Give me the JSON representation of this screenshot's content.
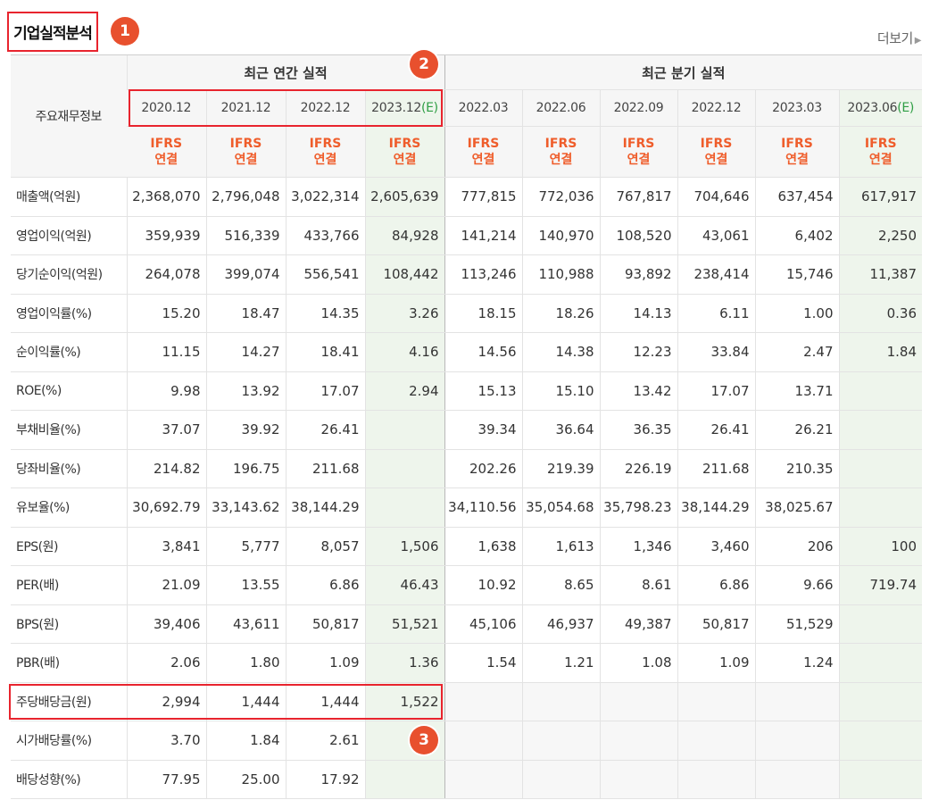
{
  "section": {
    "title": "기업실적분석",
    "more_label": "더보기"
  },
  "badges": [
    "1",
    "2",
    "3"
  ],
  "header": {
    "row_header": "주요재무정보",
    "annual_group": "최근 연간 실적",
    "quarter_group": "최근 분기 실적",
    "annual_periods": [
      {
        "label": "2020.12",
        "est": ""
      },
      {
        "label": "2021.12",
        "est": ""
      },
      {
        "label": "2022.12",
        "est": ""
      },
      {
        "label": "2023.12",
        "est": "(E)"
      }
    ],
    "quarter_periods": [
      {
        "label": "2022.03",
        "est": ""
      },
      {
        "label": "2022.06",
        "est": ""
      },
      {
        "label": "2022.09",
        "est": ""
      },
      {
        "label": "2022.12",
        "est": ""
      },
      {
        "label": "2023.03",
        "est": ""
      },
      {
        "label": "2023.06",
        "est": "(E)"
      }
    ],
    "ifrs_top": "IFRS",
    "ifrs_bottom": "연결"
  },
  "rows": [
    {
      "label": "매출액(억원)",
      "values": [
        "2,368,070",
        "2,796,048",
        "3,022,314",
        "2,605,639",
        "777,815",
        "772,036",
        "767,817",
        "704,646",
        "637,454",
        "617,917"
      ]
    },
    {
      "label": "영업이익(억원)",
      "values": [
        "359,939",
        "516,339",
        "433,766",
        "84,928",
        "141,214",
        "140,970",
        "108,520",
        "43,061",
        "6,402",
        "2,250"
      ]
    },
    {
      "label": "당기순이익(억원)",
      "values": [
        "264,078",
        "399,074",
        "556,541",
        "108,442",
        "113,246",
        "110,988",
        "93,892",
        "238,414",
        "15,746",
        "11,387"
      ]
    },
    {
      "label": "영업이익률(%)",
      "values": [
        "15.20",
        "18.47",
        "14.35",
        "3.26",
        "18.15",
        "18.26",
        "14.13",
        "6.11",
        "1.00",
        "0.36"
      ]
    },
    {
      "label": "순이익률(%)",
      "values": [
        "11.15",
        "14.27",
        "18.41",
        "4.16",
        "14.56",
        "14.38",
        "12.23",
        "33.84",
        "2.47",
        "1.84"
      ]
    },
    {
      "label": "ROE(%)",
      "values": [
        "9.98",
        "13.92",
        "17.07",
        "2.94",
        "15.13",
        "15.10",
        "13.42",
        "17.07",
        "13.71",
        ""
      ]
    },
    {
      "label": "부채비율(%)",
      "values": [
        "37.07",
        "39.92",
        "26.41",
        "",
        "39.34",
        "36.64",
        "36.35",
        "26.41",
        "26.21",
        ""
      ]
    },
    {
      "label": "당좌비율(%)",
      "values": [
        "214.82",
        "196.75",
        "211.68",
        "",
        "202.26",
        "219.39",
        "226.19",
        "211.68",
        "210.35",
        ""
      ]
    },
    {
      "label": "유보율(%)",
      "values": [
        "30,692.79",
        "33,143.62",
        "38,144.29",
        "",
        "34,110.56",
        "35,054.68",
        "35,798.23",
        "38,144.29",
        "38,025.67",
        ""
      ]
    },
    {
      "label": "EPS(원)",
      "values": [
        "3,841",
        "5,777",
        "8,057",
        "1,506",
        "1,638",
        "1,613",
        "1,346",
        "3,460",
        "206",
        "100"
      ]
    },
    {
      "label": "PER(배)",
      "values": [
        "21.09",
        "13.55",
        "6.86",
        "46.43",
        "10.92",
        "8.65",
        "8.61",
        "6.86",
        "9.66",
        "719.74"
      ]
    },
    {
      "label": "BPS(원)",
      "values": [
        "39,406",
        "43,611",
        "50,817",
        "51,521",
        "45,106",
        "46,937",
        "49,387",
        "50,817",
        "51,529",
        ""
      ]
    },
    {
      "label": "PBR(배)",
      "values": [
        "2.06",
        "1.80",
        "1.09",
        "1.36",
        "1.54",
        "1.21",
        "1.08",
        "1.09",
        "1.24",
        ""
      ]
    },
    {
      "label": "주당배당금(원)",
      "values": [
        "2,994",
        "1,444",
        "1,444",
        "1,522",
        "",
        "",
        "",
        "",
        "",
        ""
      ]
    },
    {
      "label": "시가배당률(%)",
      "values": [
        "3.70",
        "1.84",
        "2.61",
        "",
        "",
        "",
        "",
        "",
        "",
        ""
      ]
    },
    {
      "label": "배당성향(%)",
      "values": [
        "77.95",
        "25.00",
        "17.92",
        "",
        "",
        "",
        "",
        "",
        "",
        ""
      ]
    }
  ]
}
